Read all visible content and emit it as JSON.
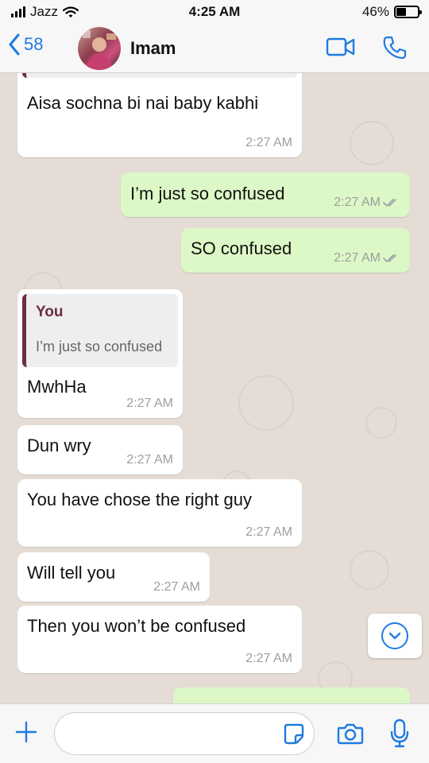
{
  "status_bar": {
    "carrier": "Jazz",
    "time": "4:25 AM",
    "battery": "46%",
    "battery_level": 0.46
  },
  "header": {
    "back_count": "58",
    "contact_name": "Imam"
  },
  "messages": [
    {
      "text": "Aisa sochna bi nai baby kabhi",
      "time": "2:27 AM",
      "direction": "in"
    },
    {
      "text": "I’m just so confused",
      "time": "2:27 AM",
      "direction": "out",
      "status": "read"
    },
    {
      "text": "SO confused",
      "time": "2:27 AM",
      "direction": "out",
      "status": "read"
    },
    {
      "text": "MwhHa",
      "time": "2:27 AM",
      "direction": "in",
      "reply_to": {
        "author": "You",
        "text": "I’m just so confused"
      }
    },
    {
      "text": "Dun wry",
      "time": "2:27 AM",
      "direction": "in"
    },
    {
      "text": "You have chose the right guy",
      "time": "2:27 AM",
      "direction": "in"
    },
    {
      "text": "Will tell you",
      "time": "2:27 AM",
      "direction": "in"
    },
    {
      "text": "Then you won’t be confused",
      "time": "2:27 AM",
      "direction": "in"
    }
  ],
  "input": {
    "value": "",
    "placeholder": ""
  },
  "colors": {
    "accent": "#1e7be0",
    "outgoing_bubble": "#dcf8c6",
    "incoming_bubble": "#ffffff",
    "chat_background": "#e5ddd5",
    "quote_author": "#6b2d44",
    "timestamp": "#9e9e9e"
  }
}
